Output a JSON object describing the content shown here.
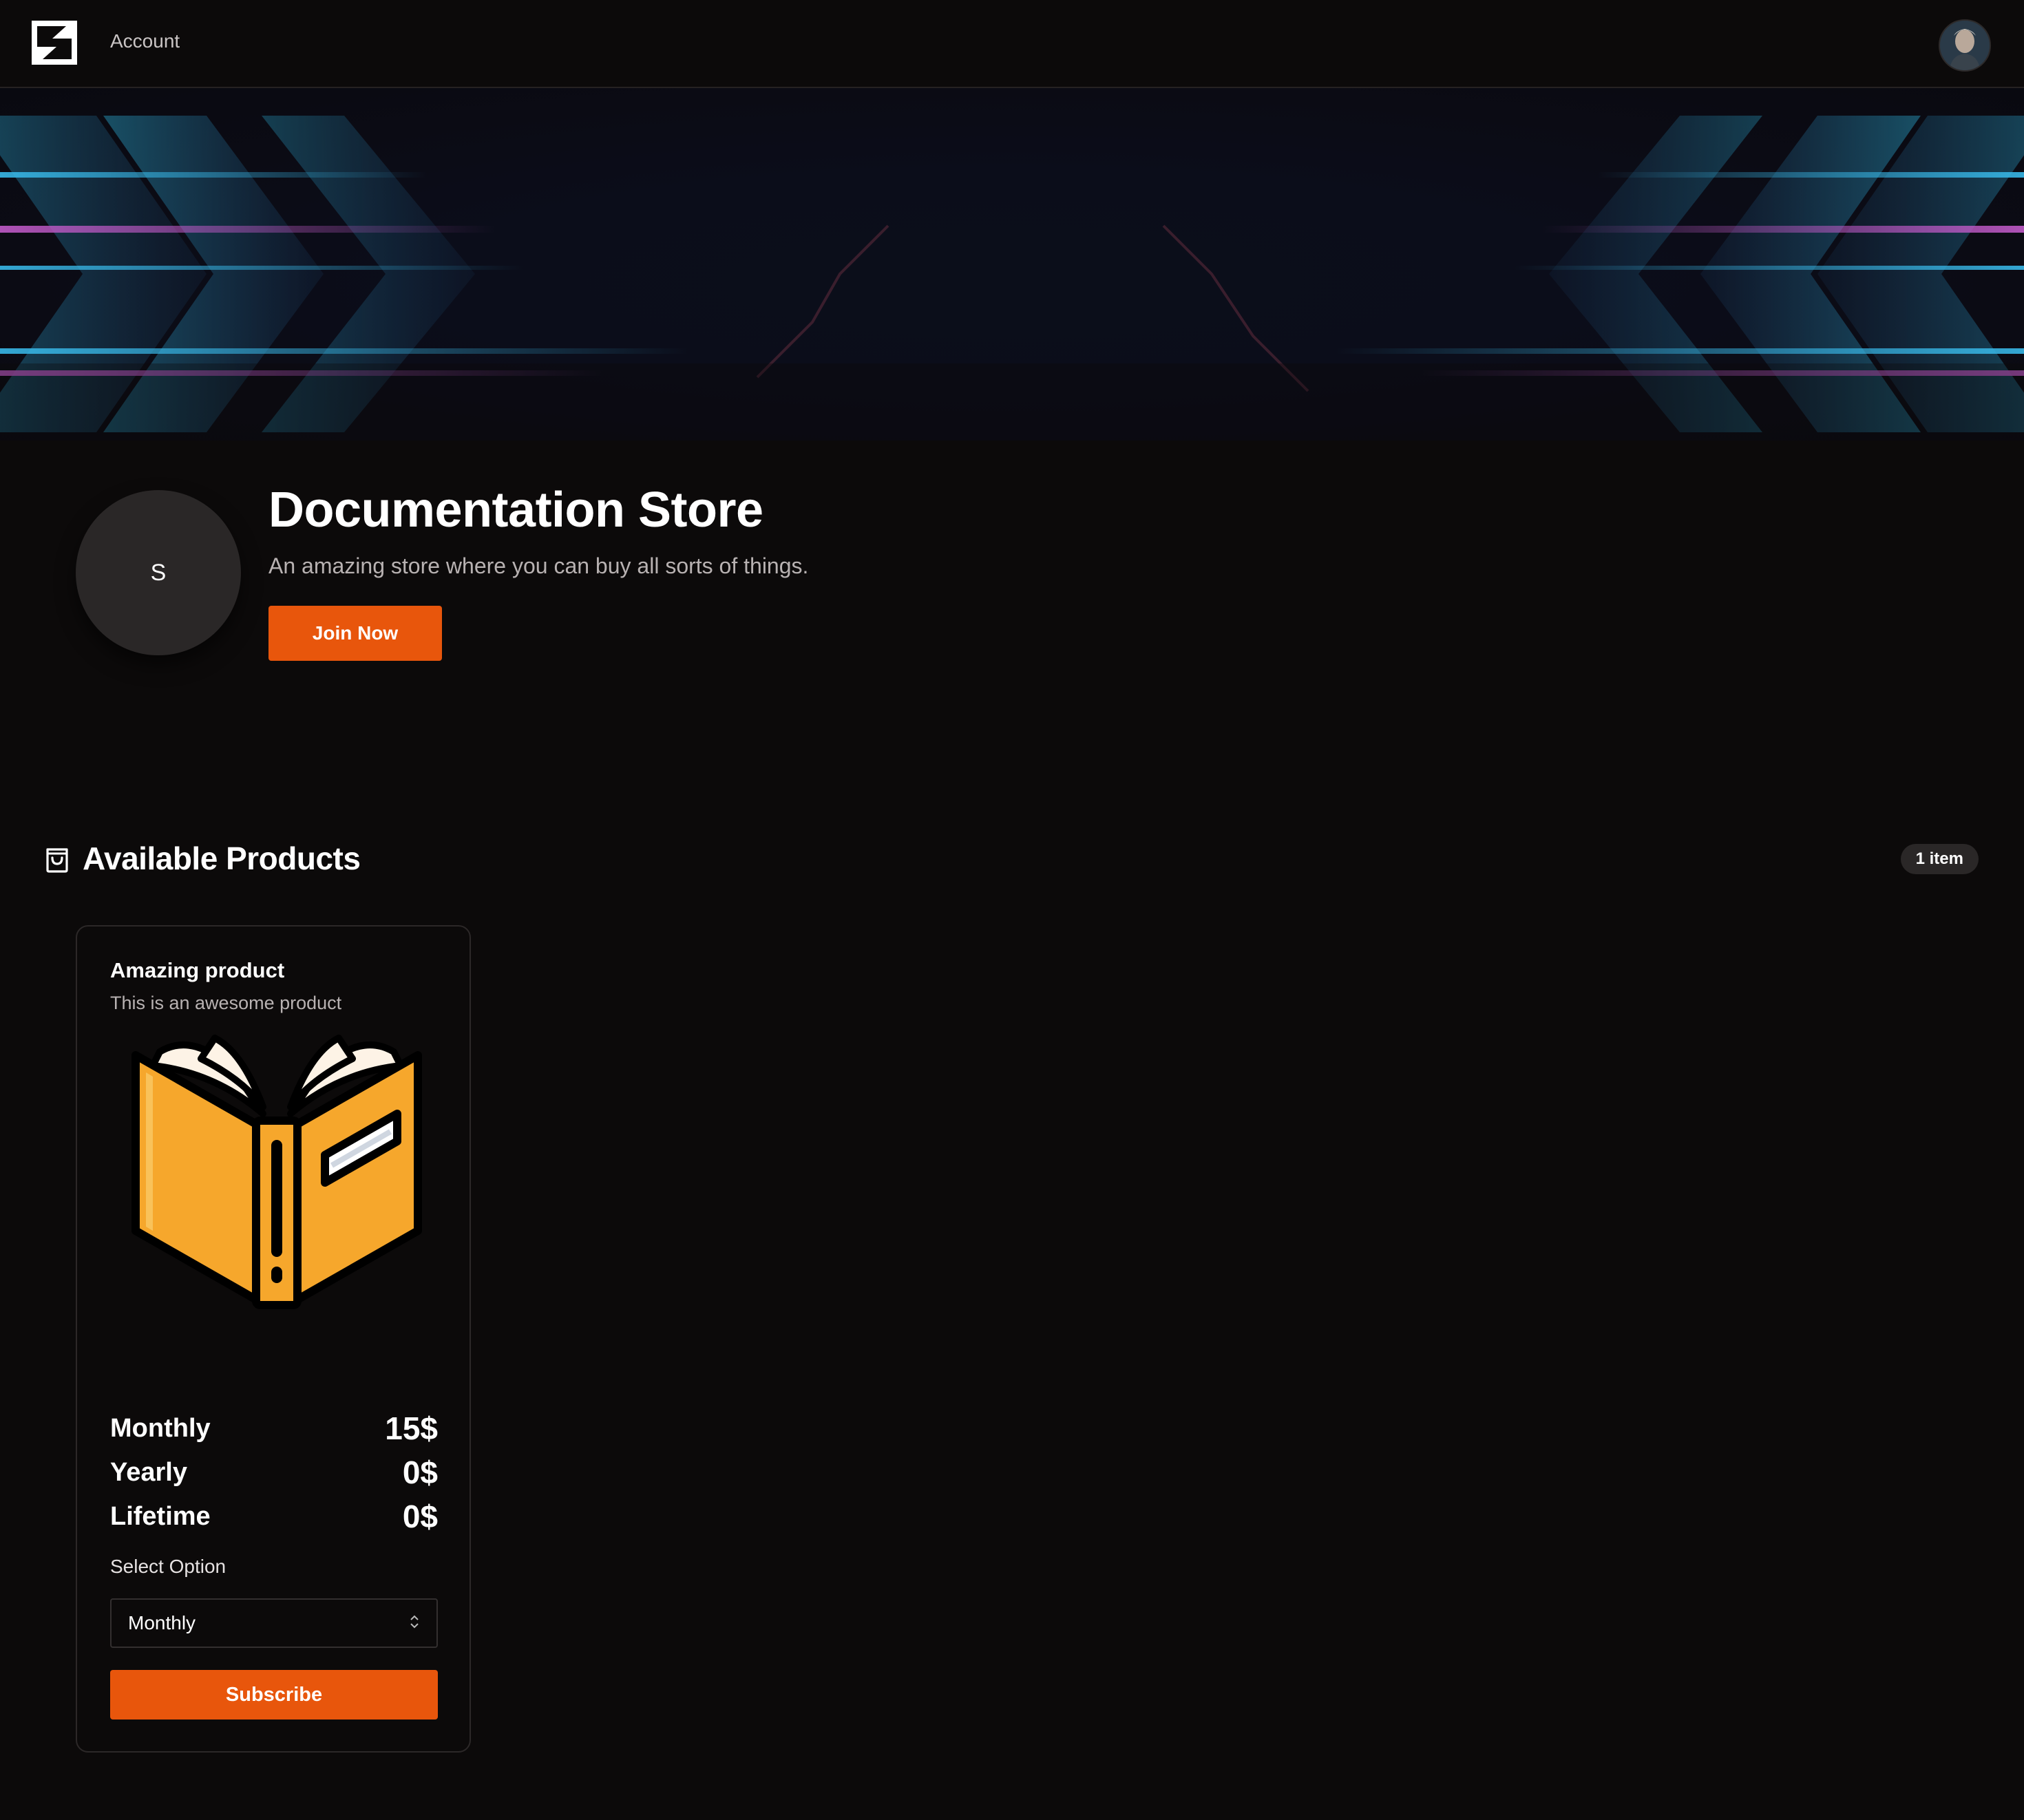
{
  "nav": {
    "account_label": "Account",
    "logo_icon": "brand-logo-icon",
    "avatar_icon": "user-avatar"
  },
  "store": {
    "avatar_letter": "S",
    "title": "Documentation Store",
    "description": "An amazing store where you can buy all sorts of things.",
    "join_label": "Join Now"
  },
  "products_section": {
    "icon": "shopping-bag-icon",
    "title": "Available Products",
    "count_label": "1 item"
  },
  "products": [
    {
      "title": "Amazing product",
      "description": "This is an awesome product",
      "image_icon": "open-book-icon",
      "prices": [
        {
          "label": "Monthly",
          "value": "15$"
        },
        {
          "label": "Yearly",
          "value": "0$"
        },
        {
          "label": "Lifetime",
          "value": "0$"
        }
      ],
      "select_label": "Select Option",
      "selected_option": "Monthly",
      "subscribe_label": "Subscribe"
    }
  ],
  "colors": {
    "background": "#0c0a0a",
    "accent": "#e8560c",
    "muted_text": "#b8b2b2",
    "book_orange": "#f6a72c"
  }
}
